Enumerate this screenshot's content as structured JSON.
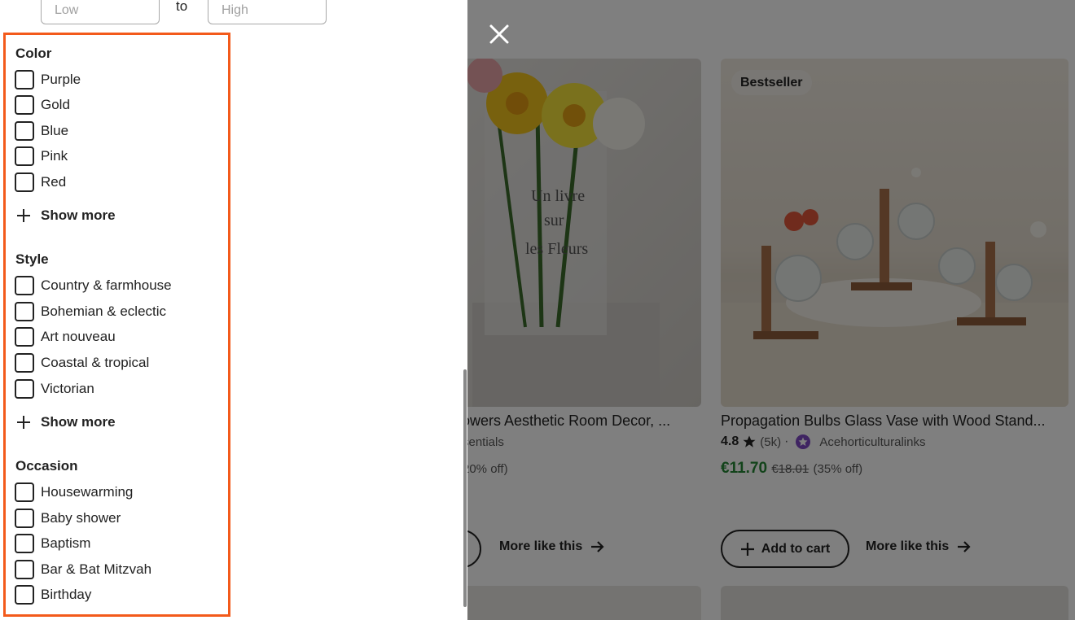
{
  "price_range": {
    "low_placeholder": "Low",
    "to_label": "to",
    "high_placeholder": "High"
  },
  "filters": {
    "color": {
      "title": "Color",
      "options": [
        "Purple",
        "Gold",
        "Blue",
        "Pink",
        "Red"
      ],
      "show_more": "Show more"
    },
    "style": {
      "title": "Style",
      "options": [
        "Country & farmhouse",
        "Bohemian & eclectic",
        "Art nouveau",
        "Coastal & tropical",
        "Victorian"
      ],
      "show_more": "Show more"
    },
    "occasion": {
      "title": "Occasion",
      "options": [
        "Housewarming",
        "Baby shower",
        "Baptism",
        "Bar & Bat Mitzvah",
        "Birthday"
      ]
    }
  },
  "products": [
    {
      "title": "owers Aesthetic Room Decor, ...",
      "shop": "sentials",
      "discount": "20% off)",
      "more_like_this": "More like this"
    },
    {
      "badge": "Bestseller",
      "title": "Propagation Bulbs Glass Vase with Wood Stand...",
      "rating": "4.8",
      "reviews": "(5k)",
      "separator": "·",
      "shop": "Acehorticulturalinks",
      "price": "€11.70",
      "original_price": "€18.01",
      "discount": "(35% off)",
      "add_to_cart": "Add to cart",
      "more_like_this": "More like this"
    }
  ],
  "colors": {
    "accent_highlight": "#f35a1b",
    "sale_price": "#258635",
    "overlay": "rgba(0,0,0,0.5)"
  }
}
